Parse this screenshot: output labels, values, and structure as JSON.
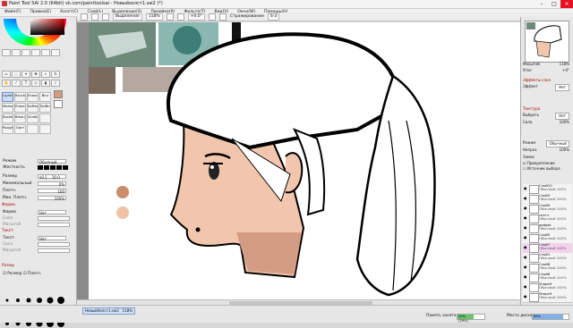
{
  "window": {
    "title": "Paint Tool SAI 2.0 (64bit) vk.com/painttoolsai - Новыйхолст1.sai2 (*)"
  },
  "menu": [
    "Файл(F)",
    "Правка(E)",
    "Холст(C)",
    "Слой(L)",
    "Выделение(S)",
    "Линейка(R)",
    "Фильтр(T)",
    "Вид(V)",
    "Окно(W)",
    "Помощь(H)"
  ],
  "toolbar": {
    "selection_label": "Выделение",
    "zoom": "118%",
    "angle": "+0.0°",
    "stabilizer_label": "Стражирование",
    "stabilizer_value": "S-3"
  },
  "left": {
    "tools": [
      {
        "label": "Lightline",
        "selected": true
      },
      {
        "label": "Brush"
      },
      {
        "label": "Eraser"
      },
      {
        "label": "Blur"
      },
      {
        "label": "Marker"
      },
      {
        "label": "Eraser"
      },
      {
        "label": "Softten"
      },
      {
        "label": "SelBru"
      },
      {
        "label": "Bucket"
      },
      {
        "label": "Binary"
      },
      {
        "label": "Gradie"
      },
      {
        "label": ""
      },
      {
        "label": "Roughp"
      },
      {
        "label": "Ласт"
      },
      {
        "label": ""
      },
      {
        "label": ""
      }
    ],
    "props": {
      "mode_label": "Режим",
      "mode_value": "Обычный",
      "hardness_label": "Жесткость",
      "size_label": "Размер",
      "size_mult": "x0.1",
      "size_value": "10.0",
      "min_label": "Минимальный",
      "min_value": "0%",
      "density_label": "Плотн.",
      "density_value": "100",
      "maxsize_label": "Мин. Плотн.",
      "maxsize_value": "100%",
      "shape_section": "Форма",
      "shape_label": "Форма",
      "shape_value": "Нет",
      "shape_sub1": "Сила",
      "shape_sub2": "Масштаб",
      "texture_section": "Текст.",
      "texture_label": "Текст.",
      "texture_value": "Нет",
      "texture_sub1": "Сила",
      "texture_sub2": "Масштаб",
      "brush_section": "Размы",
      "check1": "Размер",
      "check2": "Плотн."
    },
    "brush_sizes": [
      3,
      4,
      5,
      6,
      7,
      8,
      2,
      3,
      4,
      5,
      6,
      7,
      4,
      5,
      6,
      7,
      8,
      8
    ]
  },
  "right": {
    "zoom_label": "Масштаб",
    "zoom_value": "118%",
    "angle_label": "Угол",
    "angle_value": "+0°",
    "layer_effect_section": "Эффекты слоя",
    "effect_label": "Эффект",
    "effect_value": "Нет",
    "texture_section": "Текстура",
    "choose_label": "Выбрать",
    "choose_value": "Нет",
    "strength_label": "Сила",
    "strength_value": "100%",
    "mode_label": "Режим",
    "mode_value": "Обычный",
    "opacity_label": "Непроз.",
    "opacity_value": "100%",
    "lock_label": "Замок",
    "check_clip": "Прикрепление",
    "check_source": "Источник выбора",
    "layers": [
      {
        "name": "Слой10",
        "mode": "Обычный 100%"
      },
      {
        "name": "Слой3",
        "mode": "Обычный 100%"
      },
      {
        "name": "Слой9",
        "mode": "Обычный 100%"
      },
      {
        "name": "скетч",
        "mode": "Обычный 100%"
      },
      {
        "name": "gadget",
        "mode": "Обычный 100%"
      },
      {
        "name": "Слой5",
        "mode": "Обычный 100%"
      },
      {
        "name": "Слой7",
        "mode": "Обычный 100%",
        "selected": true
      },
      {
        "name": "Слой1",
        "mode": "Обычный 100%"
      },
      {
        "name": "Слой8",
        "mode": "Обычный 100%"
      },
      {
        "name": "Слой6",
        "mode": "Обычный 100%"
      },
      {
        "name": "Shape9",
        "mode": "Обычный 100%"
      },
      {
        "name": "Shape9",
        "mode": "Обычный 100%"
      }
    ]
  },
  "status": {
    "doc_tab": "НовыйХолст1.sai2",
    "doc_zoom": "118%",
    "memory_label": "Память занята",
    "memory_value": "20% (29%)",
    "disk_label": "Место диска",
    "disk_value": "85%"
  },
  "colors": {
    "skin": "#f1c6ad",
    "skin_shadow": "#d59c84",
    "swatch1": "#c98c6d",
    "swatch2": "#efc2a8"
  }
}
